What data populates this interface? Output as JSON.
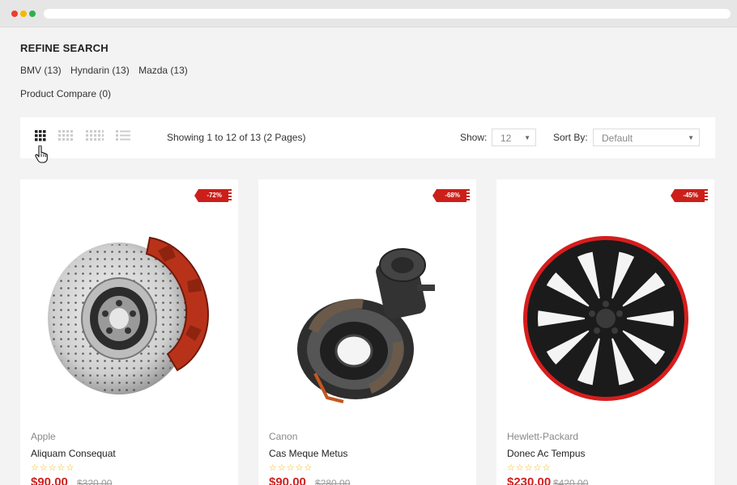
{
  "browser": {
    "colors": {
      "close": "#ee3b2f",
      "minimize": "#f5b800",
      "maximize": "#2bb24c"
    }
  },
  "refine": {
    "title": "REFINE SEARCH",
    "links": [
      "BMV (13)",
      "Hyndarin (13)",
      "Mazda (13)"
    ],
    "compare": "Product Compare (0)"
  },
  "toolbar": {
    "view_icons": [
      "grid-3-icon",
      "grid-4-icon",
      "grid-5-icon",
      "list-icon"
    ],
    "active_view": "grid-3-icon",
    "showing": "Showing 1 to 12 of 13 (2 Pages)",
    "show_label": "Show:",
    "show_value": "12",
    "sort_label": "Sort By:",
    "sort_value": "Default"
  },
  "products": [
    {
      "discount": "-72%",
      "brand": "Apple",
      "name": "Aliquam Consequat",
      "rating": "☆☆☆☆☆",
      "price": "$90.00",
      "old_price": "$320.00",
      "image": "brake-disc-image"
    },
    {
      "discount": "-68%",
      "brand": "Canon",
      "name": "Cas Meque Metus",
      "rating": "☆☆☆☆☆",
      "price": "$90.00",
      "old_price": "$280.00",
      "image": "drum-brake-image"
    },
    {
      "discount": "-45%",
      "brand": "Hewlett-Packard",
      "name": "Donec Ac Tempus",
      "rating": "☆☆☆☆☆",
      "price": "$230.00",
      "old_price": "$420.00",
      "image": "wheel-cover-image"
    }
  ],
  "colors": {
    "accent": "#cc1f1a",
    "star": "#f5b800",
    "price": "#d01f1f"
  }
}
